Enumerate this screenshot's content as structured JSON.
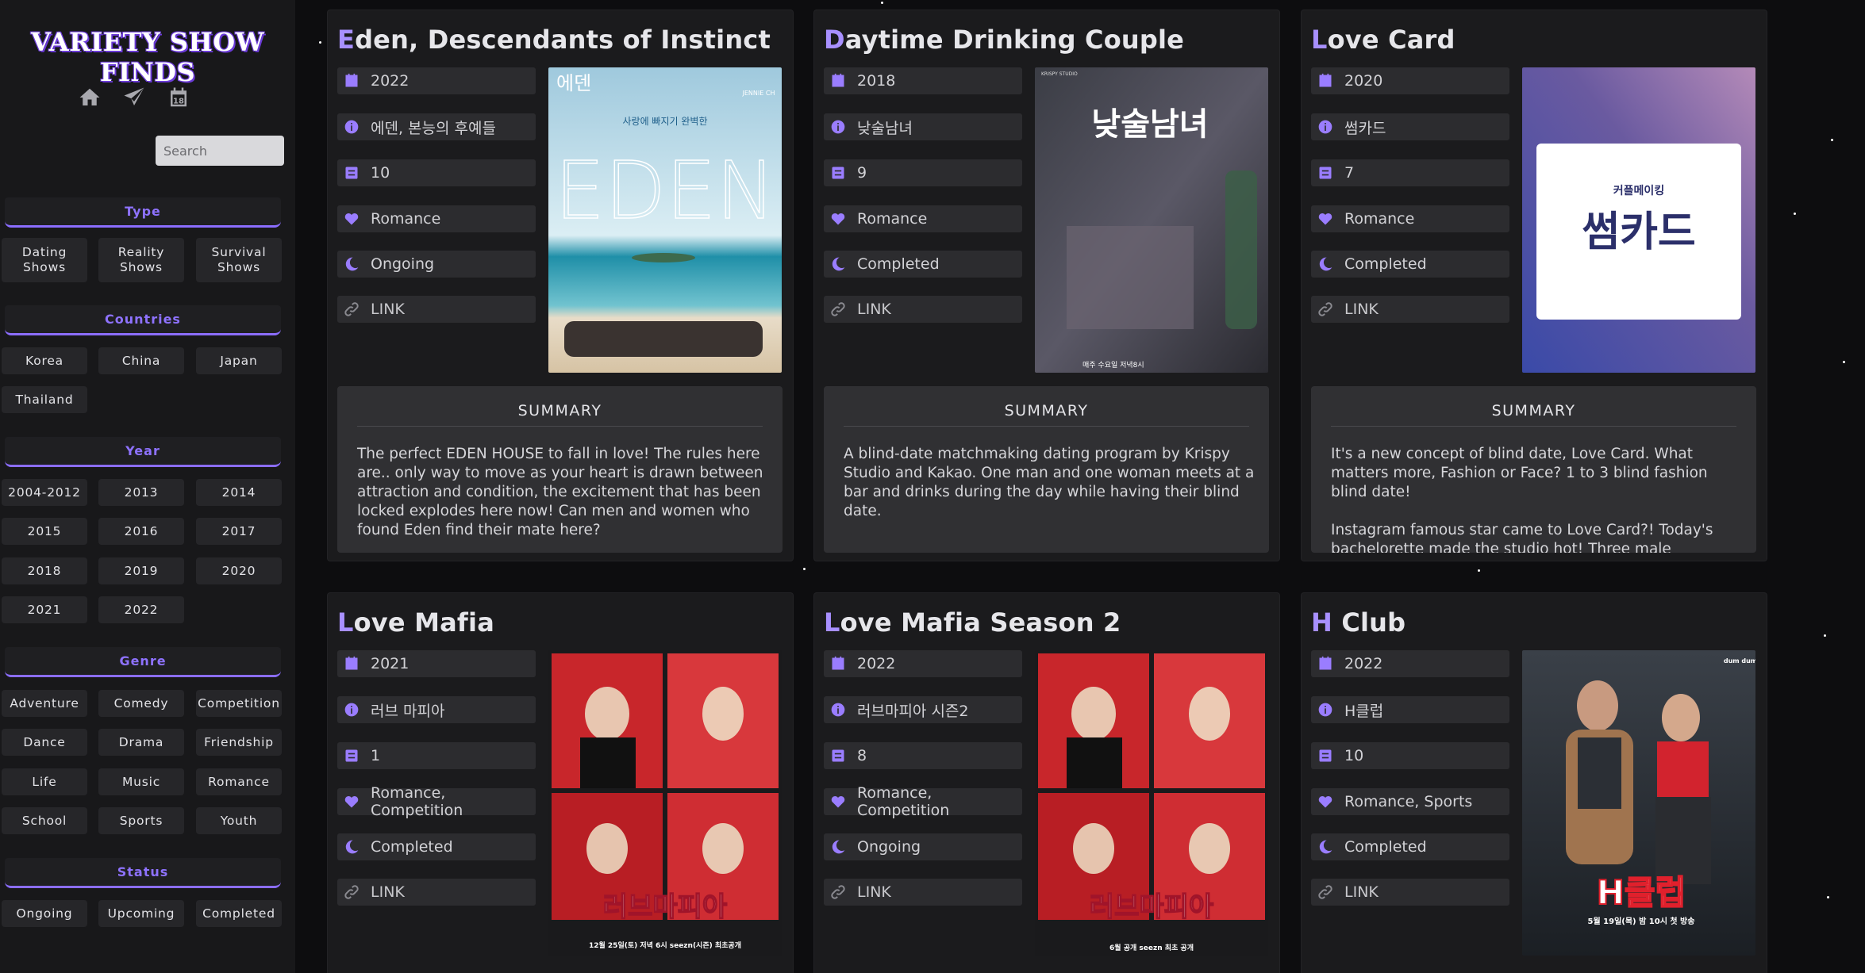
{
  "sidebar": {
    "brand": "VARIETY SHOW FINDS",
    "nav_icons": [
      "home-icon",
      "paper-plane-icon",
      "calendar-icon"
    ],
    "calendar_day": "18",
    "search_placeholder": "Search",
    "sections": {
      "type": {
        "title": "Type",
        "items": [
          "Dating\nShows",
          "Reality\nShows",
          "Survival\nShows"
        ]
      },
      "countries": {
        "title": "Countries",
        "items": [
          "Korea",
          "China",
          "Japan",
          "Thailand"
        ]
      },
      "year": {
        "title": "Year",
        "items": [
          "2004-2012",
          "2013",
          "2014",
          "2015",
          "2016",
          "2017",
          "2018",
          "2019",
          "2020",
          "2021",
          "2022"
        ]
      },
      "genre": {
        "title": "Genre",
        "items": [
          "Adventure",
          "Comedy",
          "Competition",
          "Dance",
          "Drama",
          "Friendship",
          "Life",
          "Music",
          "Romance",
          "School",
          "Sports",
          "Youth"
        ]
      },
      "status": {
        "title": "Status",
        "items": [
          "Ongoing",
          "Upcoming",
          "Completed"
        ]
      }
    }
  },
  "summary_heading": "SUMMARY",
  "cards": [
    {
      "title_first": "E",
      "title_rest": "den, Descendants of Instinct",
      "year": "2022",
      "korean": "에덴, 본능의 후예들",
      "episodes": "10",
      "genre": "Romance",
      "status": "Ongoing",
      "link": "LINK",
      "poster": {
        "top_text": "에덴",
        "tagline": "사랑에 빠지기 완벽한",
        "big": "EDEN",
        "logo": "JENNIE CH"
      },
      "summary": "The perfect EDEN HOUSE to fall in love! The rules here are.. only way to move as your heart is drawn between attraction and condition, the excitement that has been locked explodes here now! Can men and women who found Eden find their mate here?"
    },
    {
      "title_first": "D",
      "title_rest": "aytime Drinking Couple",
      "year": "2018",
      "korean": "낮술남녀",
      "episodes": "9",
      "genre": "Romance",
      "status": "Completed",
      "link": "LINK",
      "poster": {
        "big": "낮술남녀",
        "studio": "KRISPY STUDIO",
        "bottom": "매주 수요일 저녁8시"
      },
      "summary": "A blind-date matchmaking dating program by Krispy Studio and Kakao. One man and one woman meets at a bar and drinks during the day while having their blind date."
    },
    {
      "title_first": "L",
      "title_rest": "ove Card",
      "year": "2020",
      "korean": "썸카드",
      "episodes": "7",
      "genre": "Romance",
      "status": "Completed",
      "link": "LINK",
      "poster": {
        "small": "커플메이킹",
        "big": "썸카드"
      },
      "summary": "It's a new concept of blind date, Love Card. What matters more, Fashion or Face? 1 to 3 blind fashion blind date!\n\nInstagram famous star came to Love Card?! Today's bachelorette made the studio hot! Three male"
    },
    {
      "title_first": "L",
      "title_rest": "ove Mafia",
      "year": "2021",
      "korean": "러브 마피아",
      "episodes": "1",
      "genre": "Romance, Competition",
      "status": "Completed",
      "link": "LINK",
      "poster": {
        "big": "러브마피아",
        "bottom": "12월 25일(토) 저녁 6시 seezn(시즌) 최초공개"
      }
    },
    {
      "title_first": "L",
      "title_rest": "ove Mafia Season 2",
      "year": "2022",
      "korean": "러브마피아 시즌2",
      "episodes": "8",
      "genre": "Romance, Competition",
      "status": "Ongoing",
      "link": "LINK",
      "poster": {
        "big": "러브마피아",
        "bottom": "6월 공개 seezn 최초 공개"
      }
    },
    {
      "title_first": "H",
      "title_rest": " Club",
      "year": "2022",
      "korean": "H클럽",
      "episodes": "10",
      "genre": "Romance, Sports",
      "status": "Completed",
      "link": "LINK",
      "poster": {
        "big": "H클럽",
        "bottom": "5월 19일(목) 밤 10시 첫 방송",
        "logo": "dum dum"
      }
    }
  ],
  "colors": {
    "accent": "#8e72ff",
    "sidebar": "#18181a",
    "card": "#1b1b1d"
  }
}
